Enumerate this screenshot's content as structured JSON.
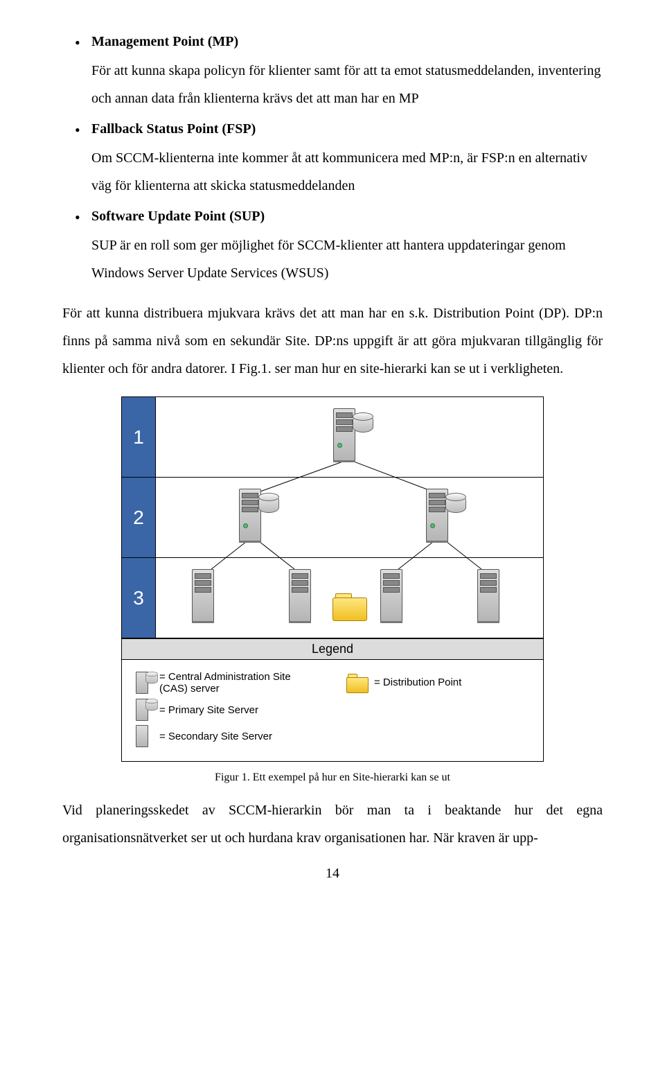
{
  "bullets": {
    "mp": {
      "head": "Management Point (MP)",
      "text": "För att kunna skapa policyn för klienter samt för att ta emot statusmeddelanden, inventering och annan data från klienterna krävs det att man har en MP"
    },
    "fsp": {
      "head": "Fallback Status Point (FSP)",
      "text": "Om SCCM-klienterna inte kommer åt att kommunicera med MP:n, är FSP:n en alternativ väg för klienterna att skicka statusmeddelanden"
    },
    "sup": {
      "head": "Software Update Point (SUP)",
      "text": "SUP är en roll som ger möjlighet för SCCM-klienter att hantera uppdateringar genom Windows Server Update Services (WSUS)"
    }
  },
  "paragraph1": "För att kunna distribuera mjukvara krävs det att man har en s.k. Distribution Point (DP). DP:n finns på samma nivå som en sekundär Site. DP:ns uppgift är att göra mjukvaran tillgänglig för klienter och för andra datorer. I Fig.1. ser man hur en site-hierarki kan se ut i verkligheten.",
  "figure": {
    "tiers": {
      "1": "1",
      "2": "2",
      "3": "3"
    },
    "legend_title": "Legend",
    "legend": {
      "cas": "= Central Administration Site (CAS) server",
      "dp": "= Distribution Point",
      "primary": "= Primary Site Server",
      "secondary": "= Secondary Site Server"
    },
    "caption": "Figur 1. Ett exempel på hur en Site-hierarki kan se ut"
  },
  "paragraph2": "Vid planeringsskedet av SCCM-hierarkin bör man ta i beaktande hur det egna organisationsnätverket ser ut och hurdana krav organisationen har. När kraven är upp-",
  "page_number": "14"
}
